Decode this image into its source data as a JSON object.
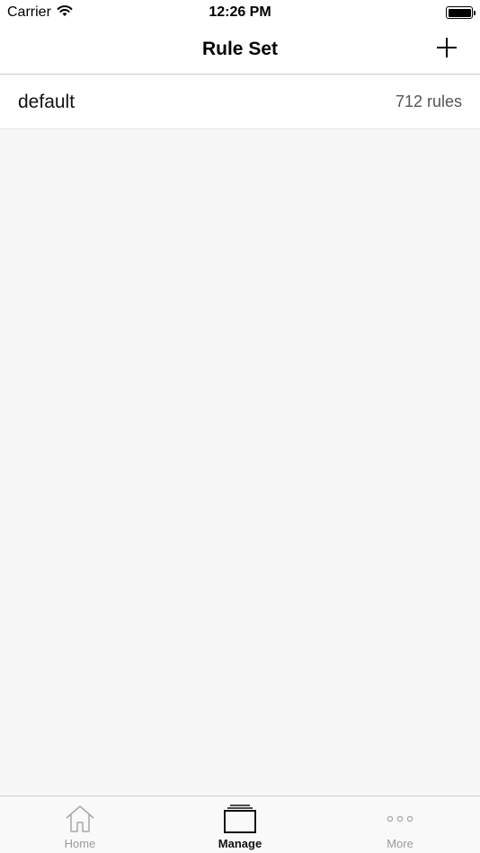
{
  "status_bar": {
    "carrier": "Carrier",
    "time": "12:26 PM"
  },
  "nav": {
    "title": "Rule Set",
    "add_icon": "plus-icon"
  },
  "rule_sets": [
    {
      "name": "default",
      "count": "712 rules"
    }
  ],
  "tabs": [
    {
      "label": "Home",
      "icon": "home-icon",
      "active": false
    },
    {
      "label": "Manage",
      "icon": "manage-icon",
      "active": true
    },
    {
      "label": "More",
      "icon": "more-icon",
      "active": false
    }
  ]
}
